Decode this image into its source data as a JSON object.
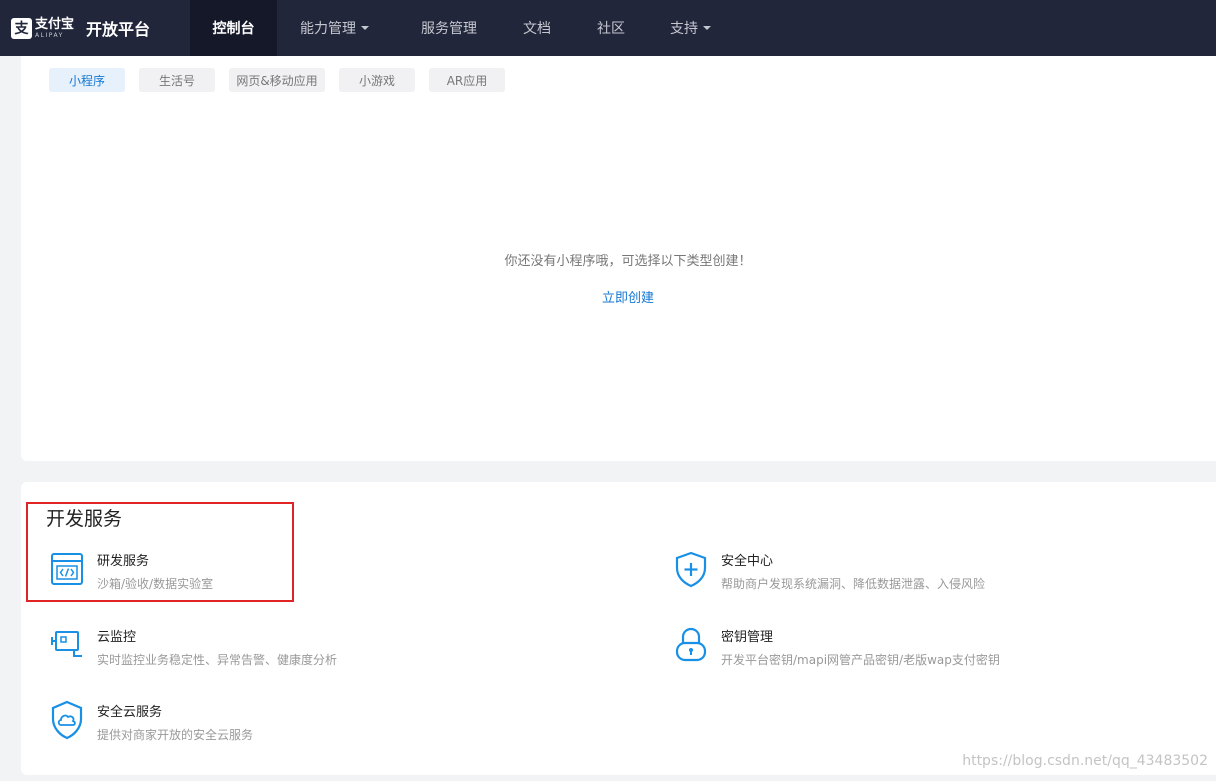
{
  "header": {
    "logo_cn": "支付宝",
    "logo_en": "ALIPAY",
    "platform": "开放平台",
    "nav": [
      {
        "label": "控制台",
        "active": true,
        "dropdown": false
      },
      {
        "label": "能力管理",
        "active": false,
        "dropdown": true
      },
      {
        "label": "服务管理",
        "active": false,
        "dropdown": false
      },
      {
        "label": "文档",
        "active": false,
        "dropdown": false
      },
      {
        "label": "社区",
        "active": false,
        "dropdown": false
      },
      {
        "label": "支持",
        "active": false,
        "dropdown": true
      }
    ]
  },
  "tabs": [
    {
      "label": "小程序",
      "active": true
    },
    {
      "label": "生活号",
      "active": false
    },
    {
      "label": "网页&移动应用",
      "active": false
    },
    {
      "label": "小游戏",
      "active": false
    },
    {
      "label": "AR应用",
      "active": false
    }
  ],
  "empty_state": {
    "message": "你还没有小程序哦，可选择以下类型创建！",
    "link": "立即创建"
  },
  "dev_services": {
    "title": "开发服务",
    "items": [
      {
        "icon": "code-window-icon",
        "title": "研发服务",
        "desc": "沙箱/验收/数据实验室"
      },
      {
        "icon": "shield-plus-icon",
        "title": "安全中心",
        "desc": "帮助商户发现系统漏洞、降低数据泄露、入侵风险"
      },
      {
        "icon": "monitor-camera-icon",
        "title": "云监控",
        "desc": "实时监控业务稳定性、异常告警、健康度分析"
      },
      {
        "icon": "lock-icon",
        "title": "密钥管理",
        "desc": "开发平台密钥/mapi网管产品密钥/老版wap支付密钥"
      },
      {
        "icon": "shield-cloud-icon",
        "title": "安全云服务",
        "desc": "提供对商家开放的安全云服务"
      }
    ]
  },
  "colors": {
    "nav_bg": "#22263a",
    "accent": "#1677d2",
    "icon_blue": "#1890e6",
    "highlight": "#e02424"
  },
  "watermark": "https://blog.csdn.net/qq_43483502"
}
